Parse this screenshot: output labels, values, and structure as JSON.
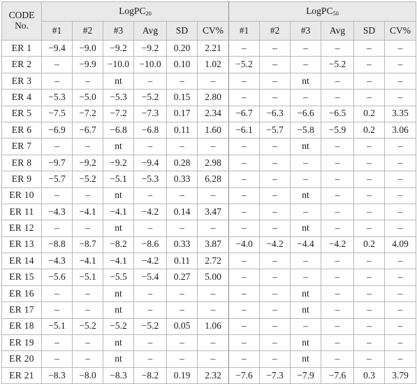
{
  "table": {
    "header": {
      "code_label_line1": "CODE",
      "code_label_line2": "No.",
      "groups": [
        {
          "name": "LogPC",
          "subscript": "20"
        },
        {
          "name": "LogPC",
          "subscript": "50"
        }
      ],
      "columns": [
        "#1",
        "#2",
        "#3",
        "Avg",
        "SD",
        "CV%"
      ]
    },
    "rows": [
      {
        "code": "ER 1",
        "pc20": [
          "−9.4",
          "−9.0",
          "−9.2",
          "−9.2",
          "0.20",
          "2.21"
        ],
        "pc50": [
          "–",
          "–",
          "–",
          "–",
          "–",
          "–"
        ]
      },
      {
        "code": "ER 2",
        "pc20": [
          "–",
          "−9.9",
          "−10.0",
          "−10.0",
          "0.10",
          "1.02"
        ],
        "pc50": [
          "−5.2",
          "–",
          "–",
          "−5.2",
          "–",
          "–"
        ]
      },
      {
        "code": "ER 3",
        "pc20": [
          "–",
          "–",
          "nt",
          "–",
          "–",
          "–"
        ],
        "pc50": [
          "–",
          "–",
          "nt",
          "–",
          "–",
          "–"
        ]
      },
      {
        "code": "ER 4",
        "pc20": [
          "−5.3",
          "−5.0",
          "−5.3",
          "−5.2",
          "0.15",
          "2.80"
        ],
        "pc50": [
          "–",
          "–",
          "–",
          "–",
          "–",
          "–"
        ]
      },
      {
        "code": "ER 5",
        "pc20": [
          "−7.5",
          "−7.2",
          "−7.2",
          "−7.3",
          "0.17",
          "2.34"
        ],
        "pc50": [
          "−6.7",
          "−6.3",
          "−6.6",
          "−6.5",
          "0.2",
          "3.35"
        ]
      },
      {
        "code": "ER 6",
        "pc20": [
          "−6.9",
          "−6.7",
          "−6.8",
          "−6.8",
          "0.11",
          "1.60"
        ],
        "pc50": [
          "−6.1",
          "−5.7",
          "−5.8",
          "−5.9",
          "0.2",
          "3.06"
        ]
      },
      {
        "code": "ER 7",
        "pc20": [
          "–",
          "–",
          "nt",
          "–",
          "–",
          "–"
        ],
        "pc50": [
          "–",
          "–",
          "nt",
          "–",
          "–",
          "–"
        ]
      },
      {
        "code": "ER 8",
        "pc20": [
          "−9.7",
          "−9.2",
          "−9.2",
          "−9.4",
          "0.28",
          "2.98"
        ],
        "pc50": [
          "–",
          "–",
          "–",
          "–",
          "–",
          "–"
        ]
      },
      {
        "code": "ER 9",
        "pc20": [
          "−5.7",
          "−5.2",
          "−5.1",
          "−5.3",
          "0.33",
          "6.28"
        ],
        "pc50": [
          "–",
          "–",
          "–",
          "–",
          "–",
          "–"
        ]
      },
      {
        "code": "ER 10",
        "pc20": [
          "–",
          "–",
          "nt",
          "–",
          "–",
          "–"
        ],
        "pc50": [
          "–",
          "–",
          "nt",
          "–",
          "–",
          "–"
        ]
      },
      {
        "code": "ER 11",
        "pc20": [
          "−4.3",
          "−4.1",
          "−4.1",
          "−4.2",
          "0.14",
          "3.47"
        ],
        "pc50": [
          "–",
          "–",
          "–",
          "–",
          "–",
          "–"
        ]
      },
      {
        "code": "ER 12",
        "pc20": [
          "–",
          "–",
          "nt",
          "–",
          "–",
          "–"
        ],
        "pc50": [
          "–",
          "–",
          "nt",
          "–",
          "–",
          "–"
        ]
      },
      {
        "code": "ER 13",
        "pc20": [
          "−8.8",
          "−8.7",
          "−8.2",
          "−8.6",
          "0.33",
          "3.87"
        ],
        "pc50": [
          "−4.0",
          "−4.2",
          "−4.4",
          "−4.2",
          "0.2",
          "4.09"
        ]
      },
      {
        "code": "ER 14",
        "pc20": [
          "−4.3",
          "−4.1",
          "−4.1",
          "−4.2",
          "0.11",
          "2.72"
        ],
        "pc50": [
          "–",
          "–",
          "–",
          "–",
          "–",
          "–"
        ]
      },
      {
        "code": "ER 15",
        "pc20": [
          "−5.6",
          "−5.1",
          "−5.5",
          "−5.4",
          "0.27",
          "5.00"
        ],
        "pc50": [
          "–",
          "–",
          "–",
          "–",
          "–",
          "–"
        ]
      },
      {
        "code": "ER 16",
        "pc20": [
          "–",
          "–",
          "nt",
          "–",
          "–",
          "–"
        ],
        "pc50": [
          "–",
          "–",
          "nt",
          "–",
          "–",
          "–"
        ]
      },
      {
        "code": "ER 17",
        "pc20": [
          "–",
          "–",
          "nt",
          "–",
          "–",
          "–"
        ],
        "pc50": [
          "–",
          "–",
          "nt",
          "–",
          "–",
          "–"
        ]
      },
      {
        "code": "ER 18",
        "pc20": [
          "−5.1",
          "−5.2",
          "−5.2",
          "−5.2",
          "0.05",
          "1.06"
        ],
        "pc50": [
          "–",
          "–",
          "–",
          "–",
          "–",
          "–"
        ]
      },
      {
        "code": "ER 19",
        "pc20": [
          "–",
          "–",
          "nt",
          "–",
          "–",
          "–"
        ],
        "pc50": [
          "–",
          "–",
          "nt",
          "–",
          "–",
          "–"
        ]
      },
      {
        "code": "ER 20",
        "pc20": [
          "–",
          "–",
          "nt",
          "–",
          "–",
          "–"
        ],
        "pc50": [
          "–",
          "–",
          "nt",
          "–",
          "–",
          "–"
        ]
      },
      {
        "code": "ER 21",
        "pc20": [
          "−8.3",
          "−8.0",
          "−8.3",
          "−8.2",
          "0.19",
          "2.32"
        ],
        "pc50": [
          "−7.6",
          "−7.3",
          "−7.9",
          "−7.6",
          "0.3",
          "3.79"
        ]
      }
    ]
  },
  "style": {
    "header_bg": "#e9e9e9",
    "border_color": "#b9b9b9",
    "outer_border_color": "#8a8a8a",
    "text_color": "#1a1a1a"
  }
}
